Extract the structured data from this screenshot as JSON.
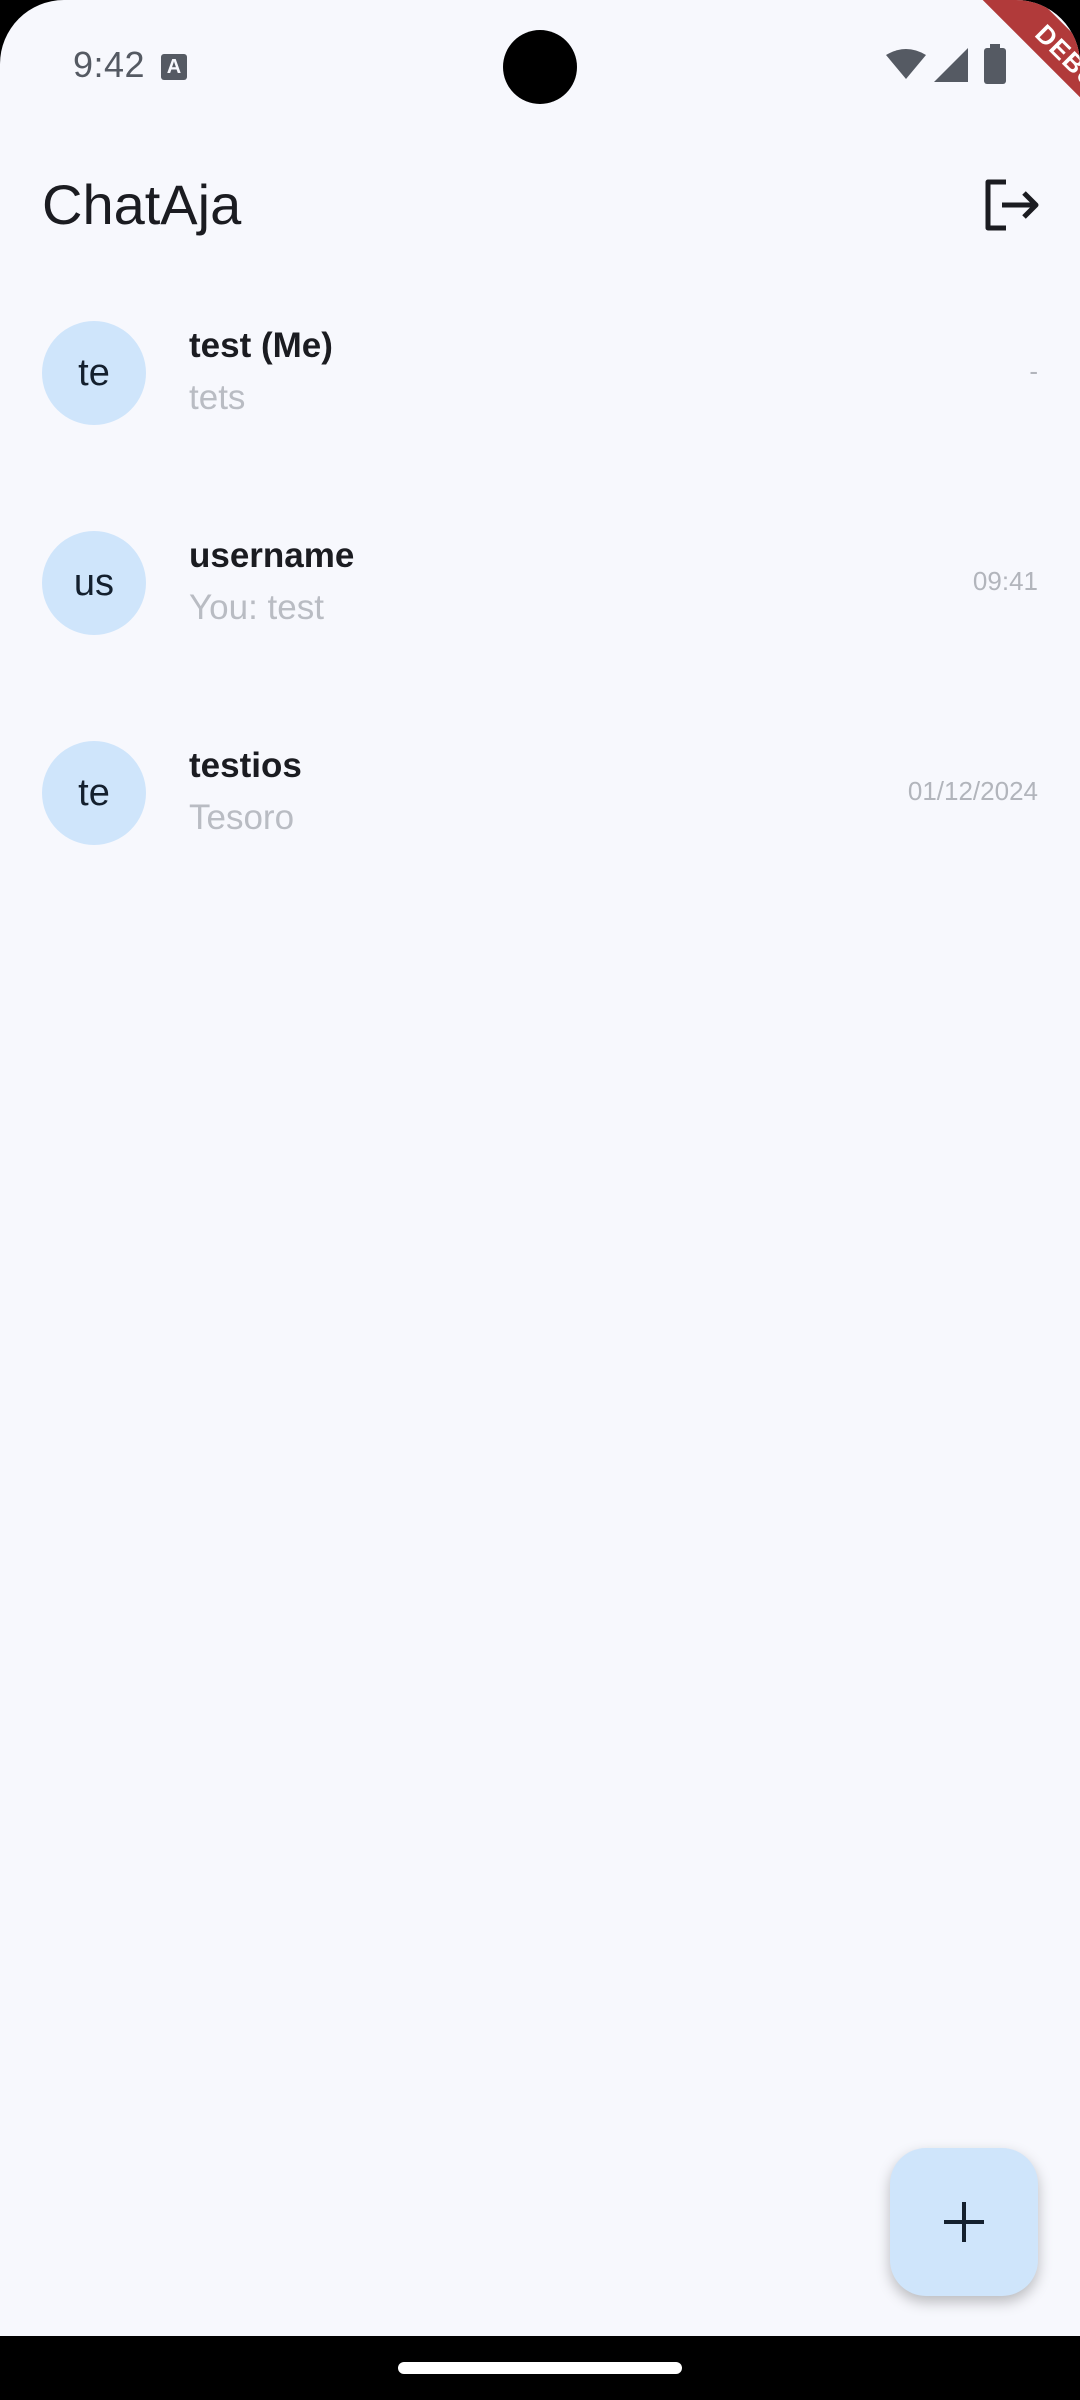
{
  "status_bar": {
    "time": "9:42",
    "notification_icon": "A",
    "icons": [
      "wifi-icon",
      "signal-icon",
      "battery-icon"
    ]
  },
  "debug_banner": "DEBUG",
  "app_bar": {
    "title": "ChatAja",
    "logout_icon": "logout-icon"
  },
  "chats": [
    {
      "avatar": "te",
      "name": "test (Me)",
      "preview": "tets",
      "time": "-"
    },
    {
      "avatar": "us",
      "name": "username",
      "preview": "You: test",
      "time": "09:41"
    },
    {
      "avatar": "te",
      "name": "testios",
      "preview": "Tesoro",
      "time": "01/12/2024"
    }
  ],
  "fab": {
    "icon": "add-icon"
  },
  "colors": {
    "background": "#f7f8fd",
    "avatar_bg": "#cfe5fb",
    "fab_bg": "#cfe5fb",
    "debug_banner": "#b13a3a"
  }
}
